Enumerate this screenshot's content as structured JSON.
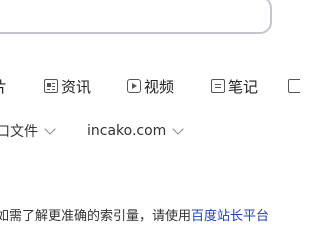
{
  "tabs": [
    {
      "label": "片",
      "icon": "partial-tab"
    },
    {
      "label": "资讯",
      "icon": "news-icon"
    },
    {
      "label": "视频",
      "icon": "video-icon"
    },
    {
      "label": "笔记",
      "icon": "note-icon"
    }
  ],
  "filters": {
    "filetype_label": "口文件",
    "site_label": "incako.com"
  },
  "notice": {
    "text": "如需了解更准确的索引量，请使用",
    "link": "百度站长平台"
  },
  "colors": {
    "link": "#2440b3",
    "icon": "#555555",
    "border": "#c4c7ce"
  }
}
